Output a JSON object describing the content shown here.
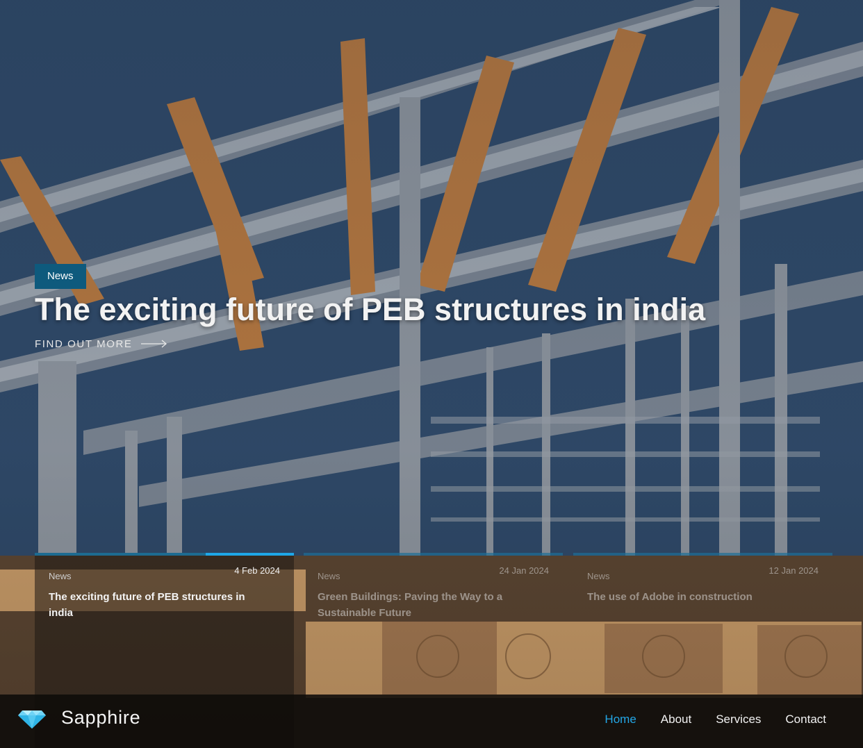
{
  "hero": {
    "category": "News",
    "headline": "The exciting future of PEB structures in india",
    "cta_label": "FIND OUT MORE"
  },
  "cards": [
    {
      "category": "News",
      "date": "4 Feb 2024",
      "title": "The exciting future of PEB structures in india",
      "progress": 0.34
    },
    {
      "category": "News",
      "date": "24 Jan 2024",
      "title": "Green Buildings: Paving the Way to a Sustainable Future"
    },
    {
      "category": "News",
      "date": "12 Jan 2024",
      "title": "The use of Adobe in construction"
    }
  ],
  "navbar": {
    "brand": "Sapphire",
    "items": [
      {
        "label": "Home",
        "active": true
      },
      {
        "label": "About"
      },
      {
        "label": "Services"
      },
      {
        "label": "Contact"
      }
    ]
  },
  "colors": {
    "accent": "#23a7e6",
    "tag_bg": "#0e5a7d"
  },
  "icons": {
    "logo": "gem-icon",
    "cta": "arrow-right-icon"
  }
}
